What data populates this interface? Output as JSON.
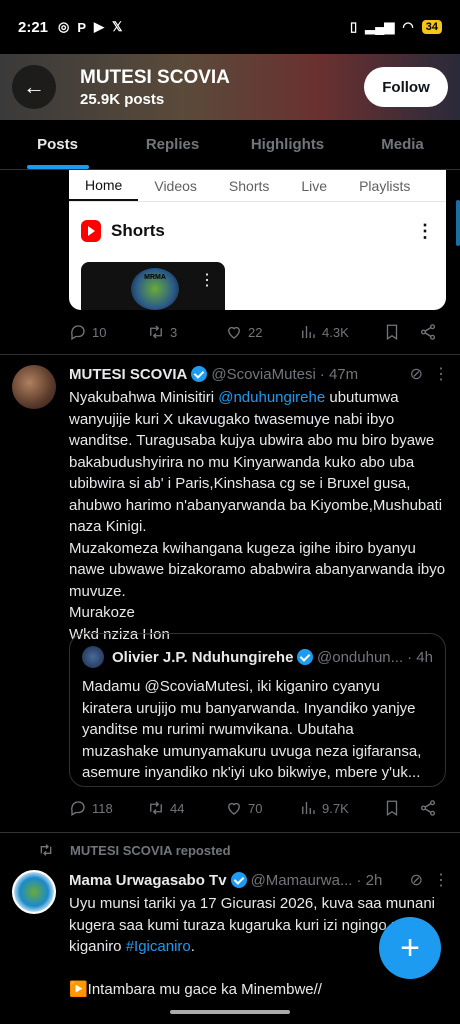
{
  "statusbar": {
    "time": "2:21",
    "notif_icons": [
      "whatsapp-icon",
      "p-icon",
      "youtube-icon",
      "x-icon"
    ],
    "battery": "34"
  },
  "header": {
    "name": "MUTESI SCOVIA",
    "post_count": "25.9K posts",
    "follow_label": "Follow"
  },
  "tabs": [
    {
      "label": "Posts"
    },
    {
      "label": "Replies"
    },
    {
      "label": "Highlights"
    },
    {
      "label": "Media"
    }
  ],
  "yt_card": {
    "tabs": [
      "Home",
      "Videos",
      "Shorts",
      "Live",
      "Playlists"
    ],
    "section": "Shorts",
    "thumb_text": "MRMA"
  },
  "post1_actions": {
    "replies": "10",
    "reposts": "3",
    "likes": "22",
    "views": "4.3K"
  },
  "tweet": {
    "name": "MUTESI SCOVIA",
    "handle": "@ScoviaMutesi",
    "time": "· 47m",
    "body_start": "Nyakubahwa Minisitiri ",
    "mention": "@nduhungirehe",
    "body_rest": " ubutumwa wanyujije kuri X ukavugako twasemuye nabi ibyo wanditse. Turagusaba kujya ubwira abo mu biro byawe bakabudushyirira no mu Kinyarwanda kuko abo uba ubibwira si ab' i Paris,Kinshasa cg se i Bruxel gusa, ahubwo harimo n'abanyarwanda ba Kiyombe,Mushubati naza Kinigi.",
    "para2": "Muzakomeza kwihangana kugeza igihe ibiro byanyu nawe ubwawe bizakoramo ababwira abanyarwanda ibyo muvuze.",
    "para3": "Murakoze",
    "para4": "Wkd nziza Hon"
  },
  "quote": {
    "name": "Olivier J.P. Nduhungirehe",
    "handle": "@onduhun...",
    "time": "· 4h",
    "body": "Madamu @ScoviaMutesi, iki kiganiro cyanyu kiratera urujijo mu banyarwanda. Inyandiko yanjye yanditse mu rurimi rwumvikana. Ubutaha muzashake umunyamakuru uvuga neza igifaransa, asemure inyandiko nk'iyi uko bikwiye, mbere y'uk..."
  },
  "post2_actions": {
    "replies": "118",
    "reposts": "44",
    "likes": "70",
    "views": "9.7K"
  },
  "repost_label": "MUTESI SCOVIA reposted",
  "tweet3": {
    "name": "Mama Urwagasabo Tv",
    "handle": "@Mamaurwa...",
    "time": "· 2h",
    "body_start": "Uyu munsi tariki ya 17 Gicurasi 2026, kuva saa munani kugera saa kumi turaza kugaruka kuri izi ngingo mu kiganiro ",
    "hashtag": "#Igicaniro",
    "body_end": ".",
    "line2": "▶️Intambara mu gace ka Minembwe//"
  },
  "fab_label": "+"
}
